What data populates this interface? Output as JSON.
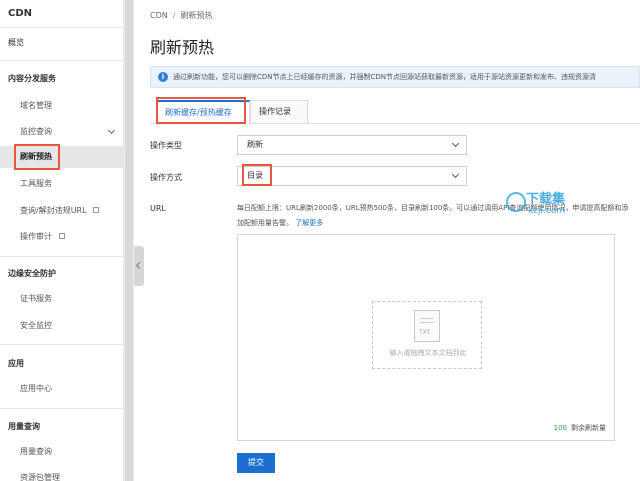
{
  "sidebar": {
    "title": "CDN",
    "overview": "概览",
    "groups": [
      {
        "label": "内容分发服务",
        "items": [
          "域名管理",
          "监控查询",
          "刷新预热",
          "工具服务",
          "查询/解封违规URL",
          "操作审计"
        ]
      },
      {
        "label": "边缘安全防护",
        "items": [
          "证书服务",
          "安全监控"
        ]
      },
      {
        "label": "应用",
        "items": [
          "应用中心"
        ]
      },
      {
        "label": "用量查询",
        "items": [
          "用量查询",
          "资源包管理"
        ]
      }
    ],
    "active_item": "刷新预热"
  },
  "breadcrumb": {
    "root": "CDN",
    "separator": "/",
    "current": "刷新预热"
  },
  "page_title": "刷新预热",
  "notice": "通过刷新功能，您可以删除CDN节点上已经缓存的资源，并强制CDN节点回源站获取最新资源，适用于源站资源更新和发布、违规资源清",
  "tabs": [
    {
      "label": "刷新缓存/预热缓存",
      "active": true
    },
    {
      "label": "操作记录",
      "active": false
    }
  ],
  "form": {
    "op_type_label": "操作类型",
    "op_type_value": "刷新",
    "op_method_label": "操作方式",
    "op_method_value": "目录",
    "url_label": "URL",
    "quota_text": "每日配额上限：URL刷新2000条，URL预热500条，目录刷新100条。可以通过调用API查询配额使用情况，申请提高配额和添加配额用量告警。",
    "learn_more": "了解更多",
    "drop_icon_text": "TXT",
    "drop_hint": "输入或拖拽文本文档到此",
    "remaining_count": "100",
    "remaining_label": "剩余刷新量",
    "submit_label": "提交"
  },
  "watermark": {
    "text": "下载集",
    "url": "xzji.com"
  },
  "colors": {
    "accent": "#1a6fd1",
    "highlight": "#e8573d",
    "notice_bg": "#eaf3fc",
    "remain_green": "#3a9b3a"
  }
}
